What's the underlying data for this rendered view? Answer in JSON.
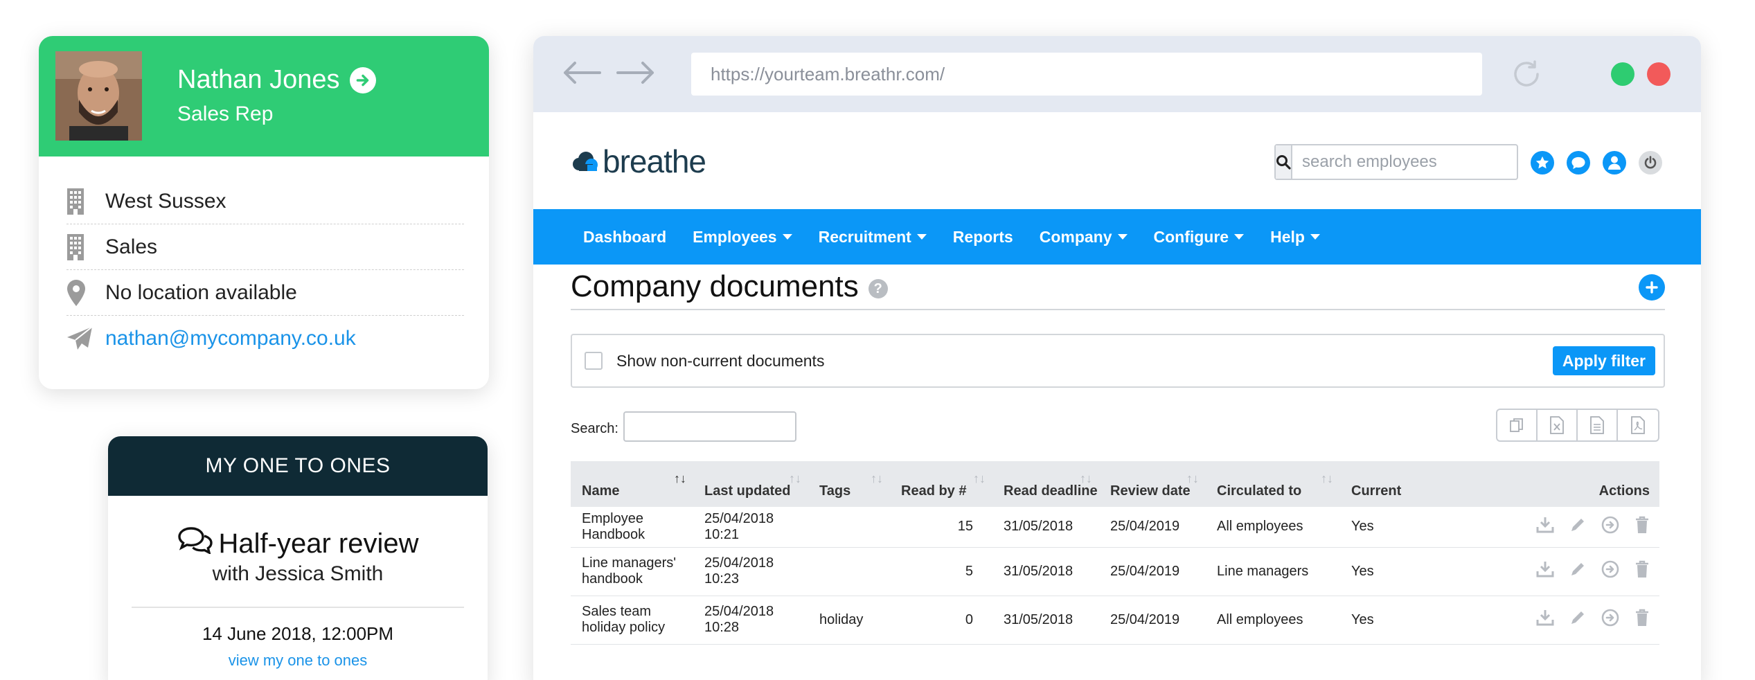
{
  "profile": {
    "name": "Nathan Jones",
    "role": "Sales Rep",
    "details": [
      {
        "icon": "building-icon",
        "text": "West Sussex"
      },
      {
        "icon": "building-icon",
        "text": "Sales"
      },
      {
        "icon": "location-pin-icon",
        "text": "No location available"
      },
      {
        "icon": "send-icon",
        "text": "nathan@mycompany.co.uk"
      }
    ],
    "header_color": "#2fcc75"
  },
  "one_to_ones": {
    "header": "MY ONE TO ONES",
    "title": "Half-year review",
    "subtitle": "with Jessica Smith",
    "date": "14 June 2018, 12:00PM",
    "link": "view my one to ones",
    "header_color": "#0f2a35"
  },
  "browser": {
    "url": "https://yourteam.breathr.com/"
  },
  "app": {
    "logo_text": "breathe",
    "search_placeholder": "search employees",
    "nav": [
      {
        "label": "Dashboard",
        "dropdown": false
      },
      {
        "label": "Employees",
        "dropdown": true
      },
      {
        "label": "Recruitment",
        "dropdown": true
      },
      {
        "label": "Reports",
        "dropdown": false
      },
      {
        "label": "Company",
        "dropdown": true
      },
      {
        "label": "Configure",
        "dropdown": true
      },
      {
        "label": "Help",
        "dropdown": true
      }
    ],
    "accent_color": "#0b97f7"
  },
  "documents": {
    "title": "Company documents",
    "filter_label": "Show non-current documents",
    "apply_filter": "Apply filter",
    "search_label": "Search:",
    "columns": {
      "name": "Name",
      "last_updated": "Last updated",
      "tags": "Tags",
      "read_by": "Read by #",
      "read_deadline": "Read deadline",
      "review_date": "Review date",
      "circulated_to": "Circulated to",
      "current": "Current",
      "actions": "Actions"
    },
    "rows": [
      {
        "name": "Employee Handbook",
        "last_updated": "25/04/2018 10:21",
        "tags": "",
        "read_by": "15",
        "read_deadline": "31/05/2018",
        "review_date": "25/04/2019",
        "circulated_to": "All employees",
        "current": "Yes"
      },
      {
        "name": "Line managers' handbook",
        "last_updated": "25/04/2018 10:23",
        "tags": "",
        "read_by": "5",
        "read_deadline": "31/05/2018",
        "review_date": "25/04/2019",
        "circulated_to": "Line managers",
        "current": "Yes"
      },
      {
        "name": "Sales team holiday policy",
        "last_updated": "25/04/2018 10:28",
        "tags": "holiday",
        "read_by": "0",
        "read_deadline": "31/05/2018",
        "review_date": "25/04/2019",
        "circulated_to": "All employees",
        "current": "Yes"
      }
    ]
  }
}
